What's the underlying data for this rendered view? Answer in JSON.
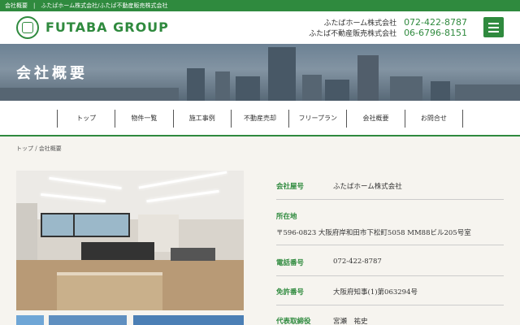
{
  "topbar": {
    "text": "会社概要　|　ふたばホーム株式会社/ふたば不動産販売株式会社"
  },
  "header": {
    "logo_text": "FUTABA GROUP",
    "contacts": [
      {
        "company": "ふたばホーム株式会社",
        "phone": "072-422-8787"
      },
      {
        "company": "ふたば不動産販売株式会社",
        "phone": "06-6796-8151"
      }
    ],
    "menu_icon": "hamburger-menu-icon"
  },
  "hero": {
    "title": "会社概要"
  },
  "nav": {
    "items": [
      "トップ",
      "物件一覧",
      "施工事例",
      "不動産売却",
      "フリープラン",
      "会社概要",
      "お問合せ"
    ]
  },
  "breadcrumb": {
    "home": "トップ",
    "separator": " / ",
    "current": "会社概要"
  },
  "company_info": {
    "name": {
      "label": "会社屋号",
      "value": "ふたばホーム株式会社"
    },
    "address": {
      "label": "所在地",
      "value": "〒596-0823 大阪府岸和田市下松町5058 MM88ビル205号室"
    },
    "phone": {
      "label": "電話番号",
      "value": "072-422-8787"
    },
    "license": {
      "label": "免許番号",
      "value": "大阪府知事(1)第063294号"
    },
    "representative": {
      "label": "代表取締役",
      "value": "宮瀬　祐史"
    }
  },
  "colors": {
    "brand_green": "#2f8a3e",
    "background": "#f6f4ef"
  }
}
